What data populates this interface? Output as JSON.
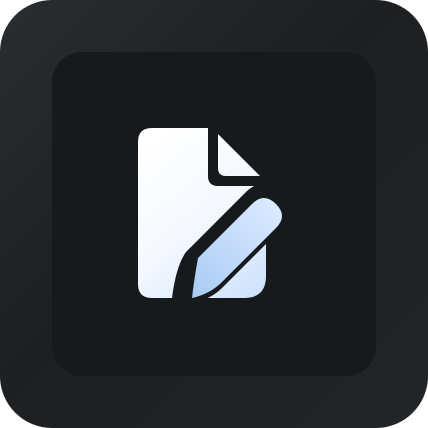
{
  "icon": {
    "name": "document-edit-icon",
    "colors": {
      "outer_background": "#222528",
      "inner_plate": "#161a1d",
      "glyph_top": "#ffffff",
      "glyph_bottom": "#bcdcff",
      "cutout": "#161a1d"
    }
  }
}
